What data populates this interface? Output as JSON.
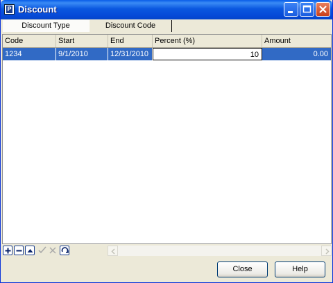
{
  "window": {
    "title": "Discount"
  },
  "tabs": [
    {
      "label": "Discount Type",
      "active": true
    },
    {
      "label": "Discount Code",
      "active": false
    }
  ],
  "table": {
    "columns": [
      "Code",
      "Start",
      "End",
      "Percent (%)",
      "Amount"
    ],
    "rows": [
      {
        "code": "1234",
        "start": "9/1/2010",
        "end": "12/31/2010",
        "percent": "10",
        "amount": "0.00"
      }
    ]
  },
  "navigator": {
    "buttons": [
      "add-icon",
      "delete-icon",
      "move-up-icon",
      "post-icon",
      "cancel-icon",
      "refresh-icon"
    ]
  },
  "buttons": {
    "close": "Close",
    "help": "Help"
  },
  "colors": {
    "title_bar": "#0a5ee8",
    "selection": "#316ac5",
    "window_bg": "#ece9d8"
  }
}
